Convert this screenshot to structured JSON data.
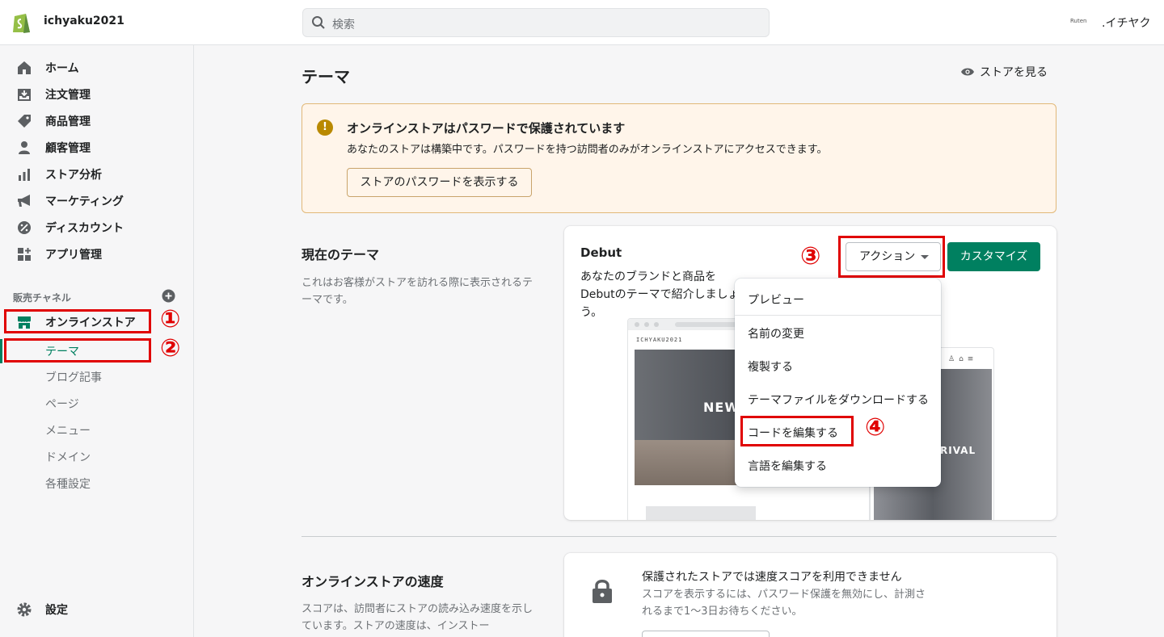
{
  "topbar": {
    "store_name": "ichyaku2021",
    "search_placeholder": "検索",
    "account_logo_text": "Ruten",
    "account_name": ".イチヤク"
  },
  "sidebar": {
    "items": [
      {
        "label": "ホーム",
        "icon": "home-icon"
      },
      {
        "label": "注文管理",
        "icon": "orders-icon"
      },
      {
        "label": "商品管理",
        "icon": "tag-icon"
      },
      {
        "label": "顧客管理",
        "icon": "person-icon"
      },
      {
        "label": "ストア分析",
        "icon": "analytics-icon"
      },
      {
        "label": "マーケティング",
        "icon": "megaphone-icon"
      },
      {
        "label": "ディスカウント",
        "icon": "discount-icon"
      },
      {
        "label": "アプリ管理",
        "icon": "apps-icon"
      }
    ],
    "channels_heading": "販売チャネル",
    "online_store_label": "オンラインストア",
    "sub_items": [
      {
        "label": "テーマ",
        "active": true
      },
      {
        "label": "ブログ記事",
        "active": false
      },
      {
        "label": "ページ",
        "active": false
      },
      {
        "label": "メニュー",
        "active": false
      },
      {
        "label": "ドメイン",
        "active": false
      },
      {
        "label": "各種設定",
        "active": false
      }
    ],
    "settings_label": "設定"
  },
  "annotations": [
    "①",
    "②",
    "③",
    "④"
  ],
  "main": {
    "title": "テーマ",
    "view_store_label": "ストアを見る",
    "banner": {
      "icon_text": "!",
      "title": "オンラインストアはパスワードで保護されています",
      "text": "あなたのストアは構築中です。パスワードを持つ訪問者のみがオンラインストアにアクセスできます。",
      "button": "ストアのパスワードを表示する"
    },
    "current_theme": {
      "section_title": "現在のテーマ",
      "section_desc": "これはお客様がストアを訪れる際に表示されるテーマです。",
      "theme_name": "Debut",
      "theme_desc": "あなたのブランドと商品をDebutのテーマで紹介しましょう。",
      "action_label": "アクション",
      "customize_label": "カスタマイズ",
      "preview": {
        "brand": "ICHYAKU2021",
        "hero_text": "NEW",
        "mobile_text": "RIVAL"
      }
    },
    "action_menu": [
      "プレビュー",
      "名前の変更",
      "複製する",
      "テーマファイルをダウンロードする",
      "コードを編集する",
      "言語を編集する"
    ],
    "speed": {
      "section_title": "オンラインストアの速度",
      "section_desc": "スコアは、訪問者にストアの読み込み速度を示しています。ストアの速度は、インストー",
      "title": "保護されたストアでは速度スコアを利用できません",
      "desc": "スコアを表示するには、パスワード保護を無効にし、計測されるまで1〜3日お待ちください。"
    }
  },
  "colors": {
    "accent": "#008060",
    "annotation": "#e00000",
    "banner_bg": "#fff5ea"
  }
}
